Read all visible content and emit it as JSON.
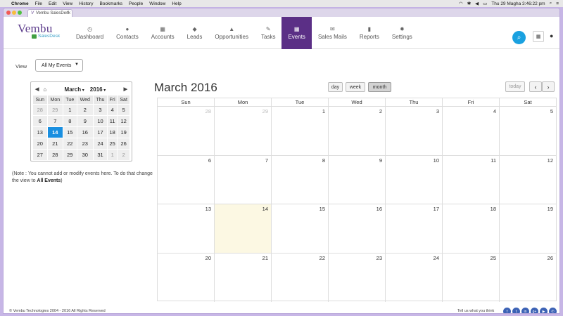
{
  "os_menubar": {
    "items": [
      "Chrome",
      "File",
      "Edit",
      "View",
      "History",
      "Bookmarks",
      "People",
      "Window",
      "Help"
    ],
    "clock": "Thu 29 Magha  3:46:22 pm"
  },
  "browser": {
    "tab_title": "Vembu SalesDesk"
  },
  "brand": {
    "name": "Vembu",
    "product": "SalesDesk"
  },
  "nav": {
    "items": [
      {
        "label": "Dashboard",
        "icon": "dashboard-icon"
      },
      {
        "label": "Contacts",
        "icon": "contacts-icon"
      },
      {
        "label": "Accounts",
        "icon": "accounts-icon"
      },
      {
        "label": "Leads",
        "icon": "leads-icon"
      },
      {
        "label": "Opportunities",
        "icon": "opportunities-icon"
      },
      {
        "label": "Tasks",
        "icon": "tasks-icon"
      },
      {
        "label": "Events",
        "icon": "events-icon"
      },
      {
        "label": "Sales Mails",
        "icon": "mail-icon"
      },
      {
        "label": "Reports",
        "icon": "reports-icon"
      },
      {
        "label": "Settings",
        "icon": "settings-icon"
      }
    ],
    "active": "Events",
    "active_color": "#5b2f86"
  },
  "view": {
    "label": "View",
    "selected": "All My Events"
  },
  "mini_calendar": {
    "month": "March",
    "year": "2016",
    "weekdays": [
      "Sun",
      "Mon",
      "Tue",
      "Wed",
      "Thu",
      "Fri",
      "Sat"
    ],
    "weeks": [
      [
        "28",
        "29",
        "1",
        "2",
        "3",
        "4",
        "5"
      ],
      [
        "6",
        "7",
        "8",
        "9",
        "10",
        "11",
        "12"
      ],
      [
        "13",
        "14",
        "15",
        "16",
        "17",
        "18",
        "19"
      ],
      [
        "20",
        "21",
        "22",
        "23",
        "24",
        "25",
        "26"
      ],
      [
        "27",
        "28",
        "29",
        "30",
        "31",
        "1",
        "2"
      ]
    ],
    "today": "14",
    "today_color": "#1a8fe0"
  },
  "note": {
    "text": "(Note : You cannot add or modify events here. To do that change the view to ",
    "bold": "All Events",
    "close": ")"
  },
  "calendar": {
    "title": "March 2016",
    "view_buttons": {
      "day": "day",
      "week": "week",
      "month": "month"
    },
    "active_view": "month",
    "today_label": "today",
    "prev_label": "‹",
    "next_label": "›",
    "weekdays": [
      "Sun",
      "Mon",
      "Tue",
      "Wed",
      "Thu",
      "Fri",
      "Sat"
    ],
    "weeks": [
      [
        "28",
        "29",
        "1",
        "2",
        "3",
        "4",
        "5"
      ],
      [
        "6",
        "7",
        "8",
        "9",
        "10",
        "11",
        "12"
      ],
      [
        "13",
        "14",
        "15",
        "16",
        "17",
        "18",
        "19"
      ],
      [
        "20",
        "21",
        "22",
        "23",
        "24",
        "25",
        "26"
      ]
    ],
    "today": "14",
    "today_bg": "#fcf8e3"
  },
  "footer": {
    "copyright": "© Vembu Technologies  2004 - 2016  All Rights Reserved",
    "tell": "Tell us what you think"
  }
}
